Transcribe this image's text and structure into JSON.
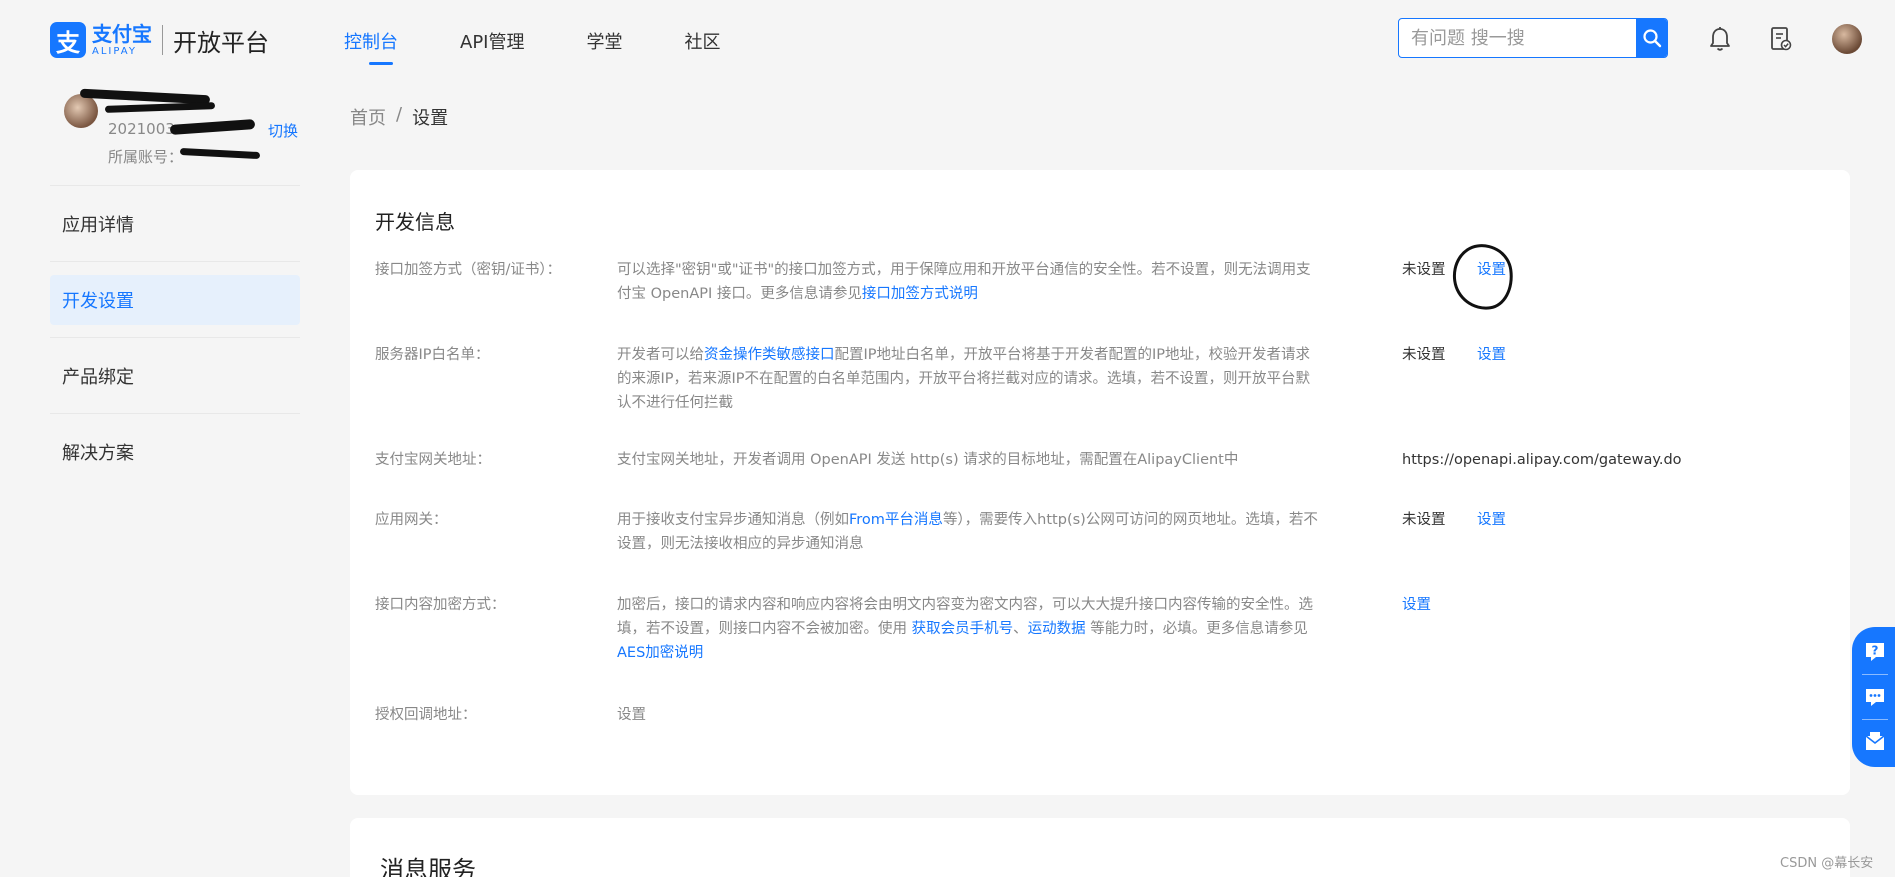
{
  "header": {
    "logo_brand": "支付宝",
    "logo_sub": "ALIPAY",
    "platform_name": "开放平台",
    "nav": [
      {
        "label": "控制台",
        "active": true
      },
      {
        "label": "API管理",
        "active": false
      },
      {
        "label": "学堂",
        "active": false
      },
      {
        "label": "社区",
        "active": false
      }
    ],
    "search_placeholder": "有问题 搜一搜",
    "icons": [
      "search-icon",
      "bell-icon",
      "document-check-icon",
      "avatar"
    ]
  },
  "sidebar": {
    "account_id": "2021003",
    "account_owner_label": "所属账号：",
    "switch_label": "切换",
    "items": [
      {
        "label": "应用详情",
        "active": false
      },
      {
        "label": "开发设置",
        "active": true
      },
      {
        "label": "产品绑定",
        "active": false
      },
      {
        "label": "解决方案",
        "active": false
      }
    ]
  },
  "breadcrumb": {
    "home": "首页",
    "sep": "/",
    "current": "设置"
  },
  "dev_info": {
    "title": "开发信息",
    "rows": [
      {
        "label": "接口加签方式（密钥/证书）：",
        "desc_lines": [
          "可以选择\"密钥\"或\"证书\"的接口加签方式，用于保障应用和开放平台通信的安全性。若不设置，则无法调用支",
          "付宝 OpenAPI 接口。更多信息请参见"
        ],
        "desc_link": "接口加签方式说明",
        "status": "未设置",
        "action": "设置"
      },
      {
        "label": "服务器IP白名单：",
        "desc_prefix": "开发者可以给",
        "desc_link": "资金操作类敏感接口",
        "desc_suffix_lines": [
          "配置IP地址白名单，开放平台将基于开发者配置的IP地址，校验开发者请求",
          "的来源IP，若来源IP不在配置的白名单范围内，开放平台将拦截对应的请求。选填，若不设置，则开放平台默",
          "认不进行任何拦截"
        ],
        "status": "未设置",
        "action": "设置"
      },
      {
        "label": "支付宝网关地址：",
        "desc": "支付宝网关地址，开发者调用 OpenAPI 发送 http(s) 请求的目标地址，需配置在AlipayClient中",
        "value": "https://openapi.alipay.com/gateway.do"
      },
      {
        "label": "应用网关：",
        "desc_prefix": "用于接收支付宝异步通知消息（例如",
        "desc_link": "From平台消息",
        "desc_suffix_lines": [
          "等），需要传入http(s)公网可访问的网页地址。选填，若不",
          "设置，则无法接收相应的异步通知消息"
        ],
        "status": "未设置",
        "action": "设置"
      },
      {
        "label": "接口内容加密方式：",
        "desc_lines": [
          "加密后，接口的请求内容和响应内容将会由明文内容变为密文内容，可以大大提升接口内容传输的安全性。选",
          "填，若不设置，则接口内容不会被加密。使用 "
        ],
        "desc_link1": "获取会员手机号",
        "desc_mid": "、",
        "desc_link2": "运动数据",
        "desc_tail": " 等能力时，必填。更多信息请参见",
        "desc_link3": "AES加密说明",
        "action": "设置"
      },
      {
        "label": "授权回调地址：",
        "action": "设置"
      }
    ]
  },
  "message_service": {
    "title": "消息服务"
  },
  "float_tools": [
    "help-icon",
    "chat-icon",
    "mail-icon"
  ],
  "watermark": "CSDN @幕长安",
  "colors": {
    "accent": "#1677ff",
    "background": "#f5f5f5",
    "card": "#ffffff",
    "muted_text": "#888888"
  }
}
